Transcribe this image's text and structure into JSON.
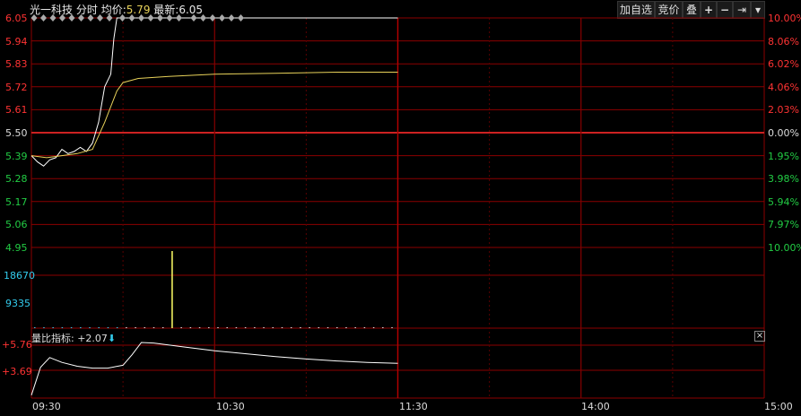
{
  "header": {
    "stock_name": "光一科技",
    "mode": "分时",
    "avg_label": "均价:",
    "avg_value": "5.79",
    "latest_label": "最新:",
    "latest_value": "6.05",
    "buttons": [
      "加自选",
      "竞价",
      "叠",
      "+",
      "−",
      "⇥",
      "▾"
    ]
  },
  "price_axis_left": [
    "6.05",
    "5.94",
    "5.83",
    "5.72",
    "5.61",
    "5.50",
    "5.39",
    "5.28",
    "5.17",
    "5.06",
    "4.95"
  ],
  "pct_axis_right": [
    "10.00%",
    "8.06%",
    "6.02%",
    "4.06%",
    "2.03%",
    "0.00%",
    "1.95%",
    "3.98%",
    "5.94%",
    "7.97%",
    "10.00%"
  ],
  "volume_axis": [
    "18670",
    "9335"
  ],
  "indicator": {
    "label": "量比指标: +2.07",
    "arrow": "⬇",
    "axis": [
      "+5.76",
      "+3.69"
    ],
    "close": "×"
  },
  "time_axis": [
    "09:30",
    "10:30",
    "11:30",
    "14:00",
    "15:00"
  ],
  "colors": {
    "grid_major": "#8b0000",
    "grid_minor": "#5a0000",
    "up": "#ff3333",
    "down": "#22cc44",
    "neutral": "#dddddd",
    "price_line": "#ffffff",
    "avg_line": "#e8d25a",
    "volume_tick": "#33ccee"
  },
  "chart_data": {
    "type": "line",
    "x_range": [
      "09:30",
      "15:00"
    ],
    "y_range": [
      4.95,
      6.05
    ],
    "prev_close": 5.5,
    "series": [
      {
        "values": [
          [
            0,
            5.39
          ],
          [
            2,
            5.36
          ],
          [
            4,
            5.34
          ],
          [
            6,
            5.37
          ],
          [
            8,
            5.38
          ],
          [
            10,
            5.42
          ],
          [
            12,
            5.4
          ],
          [
            14,
            5.41
          ],
          [
            16,
            5.43
          ],
          [
            18,
            5.41
          ],
          [
            20,
            5.45
          ],
          [
            22,
            5.55
          ],
          [
            24,
            5.72
          ],
          [
            26,
            5.78
          ],
          [
            27,
            5.95
          ],
          [
            28,
            6.05
          ],
          [
            30,
            6.05
          ],
          [
            40,
            6.05
          ],
          [
            60,
            6.05
          ],
          [
            90,
            6.05
          ],
          [
            120,
            6.05
          ]
        ]
      },
      {
        "values": [
          [
            0,
            5.39
          ],
          [
            5,
            5.38
          ],
          [
            10,
            5.39
          ],
          [
            15,
            5.4
          ],
          [
            20,
            5.42
          ],
          [
            24,
            5.55
          ],
          [
            28,
            5.7
          ],
          [
            30,
            5.74
          ],
          [
            35,
            5.76
          ],
          [
            45,
            5.77
          ],
          [
            60,
            5.78
          ],
          [
            80,
            5.785
          ],
          [
            100,
            5.79
          ],
          [
            120,
            5.79
          ]
        ]
      }
    ],
    "volume": [
      4,
      5,
      3,
      3,
      2,
      3,
      2,
      2,
      3,
      2,
      4,
      6,
      9,
      12,
      15,
      18670,
      10,
      8,
      6,
      5,
      4,
      4,
      3,
      3,
      3,
      2,
      2,
      2,
      2,
      2,
      2,
      2,
      2,
      2,
      2,
      2,
      2,
      2,
      2,
      2
    ],
    "volume_range": [
      0,
      18670
    ],
    "indicator_series": [
      [
        0,
        0.3
      ],
      [
        3,
        3.2
      ],
      [
        6,
        4.2
      ],
      [
        10,
        3.7
      ],
      [
        15,
        3.3
      ],
      [
        20,
        3.1
      ],
      [
        25,
        3.1
      ],
      [
        30,
        3.4
      ],
      [
        33,
        4.5
      ],
      [
        36,
        5.76
      ],
      [
        40,
        5.7
      ],
      [
        50,
        5.3
      ],
      [
        60,
        4.9
      ],
      [
        70,
        4.6
      ],
      [
        80,
        4.3
      ],
      [
        90,
        4.05
      ],
      [
        100,
        3.85
      ],
      [
        110,
        3.7
      ],
      [
        120,
        3.6
      ]
    ],
    "indicator_range": [
      0,
      5.76
    ]
  }
}
